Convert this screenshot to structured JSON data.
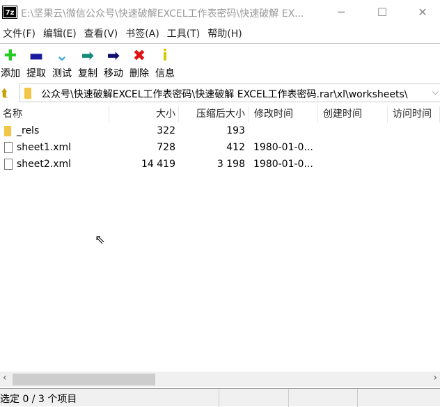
{
  "window": {
    "title": "E:\\坚果云\\微信公众号\\快速破解EXCEL工作表密码\\快速破解 EX...",
    "app_icon": "7z",
    "minimize": "─",
    "maximize": "☐",
    "close": "✕"
  },
  "menu": [
    "文件(F)",
    "编辑(E)",
    "查看(V)",
    "书签(A)",
    "工具(T)",
    "帮助(H)"
  ],
  "toolbar": [
    {
      "label": "添加",
      "icon": "plus-icon",
      "glyph": "✚",
      "color": "#22cc22"
    },
    {
      "label": "提取",
      "icon": "minus-icon",
      "glyph": "▬",
      "color": "#1a1aa0"
    },
    {
      "label": "测试",
      "icon": "check-icon",
      "glyph": "⌄",
      "color": "#3aa7e0"
    },
    {
      "label": "复制",
      "icon": "copy-arrow-icon",
      "glyph": "➡",
      "color": "#138a7a"
    },
    {
      "label": "移动",
      "icon": "move-arrow-icon",
      "glyph": "➡",
      "color": "#101070"
    },
    {
      "label": "删除",
      "icon": "delete-icon",
      "glyph": "✖",
      "color": "#e01010"
    },
    {
      "label": "信息",
      "icon": "info-icon",
      "glyph": "i",
      "color": "#d4c800"
    }
  ],
  "address": {
    "path": "公众号\\快速破解EXCEL工作表密码\\快速破解 EXCEL工作表密码.rar\\xl\\worksheets\\",
    "dropdown": "⌵"
  },
  "columns": [
    "名称",
    "大小",
    "压缩后大小",
    "修改时间",
    "创建时间",
    "访问时间"
  ],
  "rows": [
    {
      "type": "folder",
      "name": "_rels",
      "size": "322",
      "packed": "193",
      "modified": ""
    },
    {
      "type": "file",
      "name": "sheet1.xml",
      "size": "728",
      "packed": "412",
      "modified": "1980-01-0..."
    },
    {
      "type": "file",
      "name": "sheet2.xml",
      "size": "14 419",
      "packed": "3 198",
      "modified": "1980-01-0..."
    }
  ],
  "scroll": {
    "left": "‹",
    "right": "›"
  },
  "status": {
    "text": "选定 0 / 3 个项目"
  }
}
